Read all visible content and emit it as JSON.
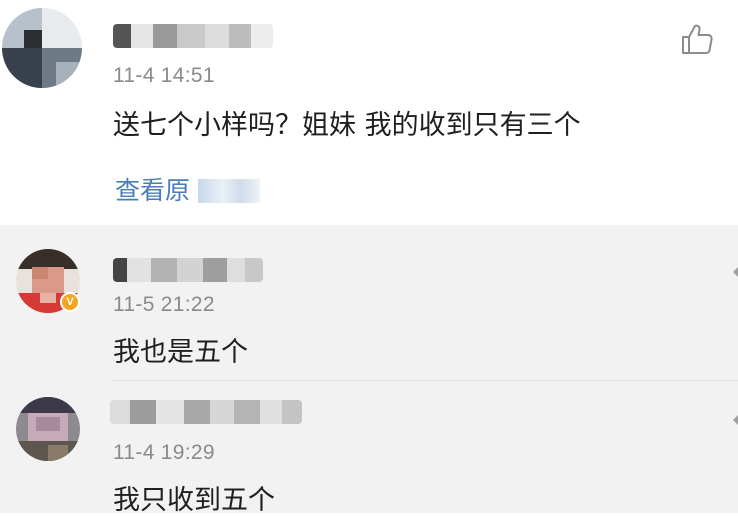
{
  "main": {
    "time": "11-4 14:51",
    "text": "送七个小样吗？姐妹 我的收到只有三个",
    "link": "查看原"
  },
  "replies": [
    {
      "time": "11-5 21:22",
      "text": "我也是五个",
      "badge": "V"
    },
    {
      "time": "11-4 19:29",
      "text": "我只收到五个"
    }
  ],
  "icons": {
    "like": "thumbs-up-icon",
    "badge": "verified-badge-icon",
    "more": "more-icon"
  },
  "colors": {
    "link": "#4a7db8",
    "badge": "#f4a41f",
    "reply_background": "#f2f2f2"
  }
}
